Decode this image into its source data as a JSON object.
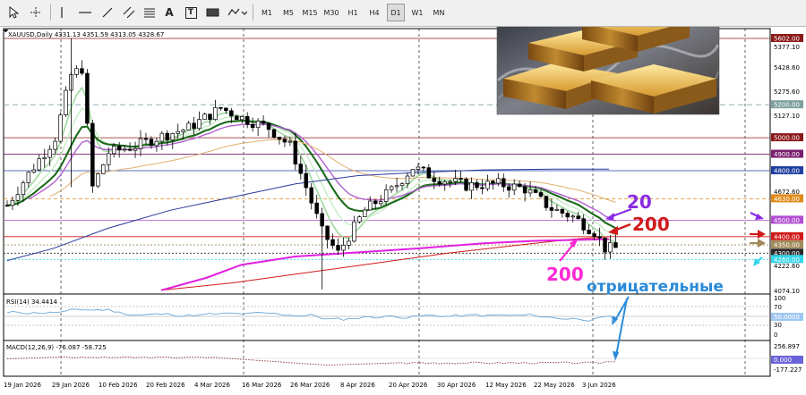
{
  "toolbar": {
    "tools": [
      {
        "name": "cursor-tool",
        "icon": "cursor-icon"
      },
      {
        "name": "crosshair-tool",
        "icon": "crosshair-icon"
      },
      {
        "name": "vertical-line-tool",
        "icon": "vertical-line-icon"
      },
      {
        "name": "horizontal-line-tool",
        "icon": "horizontal-line-icon"
      },
      {
        "name": "trendline-tool",
        "icon": "trendline-icon"
      },
      {
        "name": "channel-tool",
        "icon": "equidistant-channel-icon"
      },
      {
        "name": "fibonacci-tool",
        "icon": "fibonacci-icon"
      },
      {
        "name": "text-tool",
        "icon": "text-icon"
      },
      {
        "name": "text-label-tool",
        "icon": "text-label-icon"
      },
      {
        "name": "shapes-tool",
        "icon": "shapes-icon"
      }
    ],
    "text_tool_label": "A",
    "text_label_tool_label": "T",
    "timeframes": [
      "M1",
      "M5",
      "M15",
      "M30",
      "H1",
      "H4",
      "D1",
      "W1",
      "MN"
    ],
    "active_timeframe": "D1"
  },
  "chart": {
    "info": "XAUUSD,Daily  4331.13 4351.59 4313.05 4328.67",
    "price_scale": [
      "5377.10",
      "5428.60",
      "5275.60",
      "5127.10",
      "4672.60",
      "4222.60",
      "4074.10"
    ],
    "level_tags": [
      {
        "text": "5602.00",
        "color": "#8b1a1a",
        "price": 5602
      },
      {
        "text": "5200.00",
        "color": "#7f9f9f",
        "price": 5200
      },
      {
        "text": "5000.00",
        "color": "#8b1a1a",
        "price": 5000
      },
      {
        "text": "4900.00",
        "color": "#7a1f6e",
        "price": 4900
      },
      {
        "text": "4800.00",
        "color": "#1f3fa0",
        "price": 4800
      },
      {
        "text": "4630.00",
        "color": "#e08a1a",
        "price": 4630
      },
      {
        "text": "4500.00",
        "color": "#b24dd0",
        "price": 4500
      },
      {
        "text": "4400.00",
        "color": "#d01a1a",
        "price": 4400
      },
      {
        "text": "4350.00",
        "color": "#a08a5a",
        "price": 4350
      },
      {
        "text": "4300.00",
        "color": "#2a2a2a",
        "price": 4300
      },
      {
        "text": "4260.00",
        "color": "#33d5e8",
        "price": 4262
      }
    ],
    "time_labels": [
      "19 Jan 2026",
      "29 Jan 2026",
      "10 Feb 2026",
      "20 Feb 2026",
      "4 Mar 2026",
      "16 Mar 2026",
      "26 Mar 2026",
      "8 Apr 2026",
      "20 Apr 2026",
      "30 Apr 2026",
      "12 May 2026",
      "22 May 2026",
      "3 Jun 2026"
    ],
    "annotations": {
      "ma20": "20",
      "ma200_red": "200",
      "ma200_magenta": "200",
      "negative": "отрицательные"
    },
    "photo_icon": "gold-bars-photo"
  },
  "rsi": {
    "info": "RSI(14) 34.4414",
    "scale": [
      "100",
      "70",
      "50.0000",
      "30",
      "0"
    ],
    "value": 34.44
  },
  "macd": {
    "info": "MACD(12,26,9) -76.087 -58.725",
    "scale": [
      "256.897",
      "0.000",
      "-177.227"
    ]
  },
  "colors": {
    "bull_candle": "#ffffff",
    "bear_candle": "#000000",
    "ma_dark_green": "#1b6b1b",
    "ma_light_green": "#9fd89f",
    "ma_magenta": "#e020e0",
    "ma_violet": "#b060d0",
    "ma_tan": "#e0b070",
    "ma_navy": "#2a3a9a",
    "rsi_line": "#6aa7d8",
    "macd_line": "#8b2f2f"
  }
}
